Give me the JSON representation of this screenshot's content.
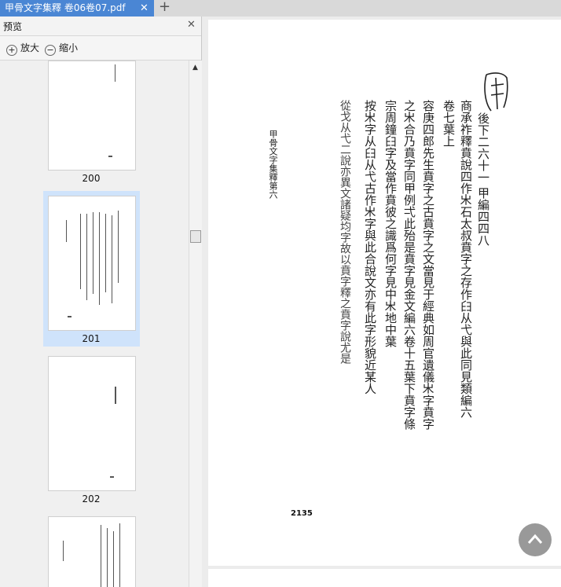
{
  "tab": {
    "title": "甲骨文字集釋 卷06卷07.pdf",
    "close": "✕",
    "add": "+"
  },
  "panel": {
    "title": "预览",
    "close": "✕",
    "zoom_in": "放大",
    "zoom_out": "缩小",
    "thumbnails": [
      {
        "label": "200"
      },
      {
        "label": "201"
      },
      {
        "label": "202"
      }
    ]
  },
  "page": {
    "page_number": "2135",
    "running_head": "甲骨文字集釋第六",
    "columns": [
      "後下二六十一 甲編四四八",
      "商承祚釋賁說四作𣎵石太叔賁字之存作𦥑从弋與此同見類編六",
      "卷七葉上",
      "容庚四郎先生賁字之古賁字之文當見于經典如周官遺儀𣎵字賁字",
      "之𣎵合乃賁字同甲例弌此殆是賁字見金文編六卷十五葉下賁字條",
      "宗周鐘𦥑字及當作賁彼之識爲何字見中𣎵地中葉",
      "按𣎵字从𦥑从弋古作𣎵字與此合說文亦有此字形貌近某人",
      "從戈从弋二說亦異文諸疑均字故以賁字釋之賁字說尤是"
    ]
  }
}
